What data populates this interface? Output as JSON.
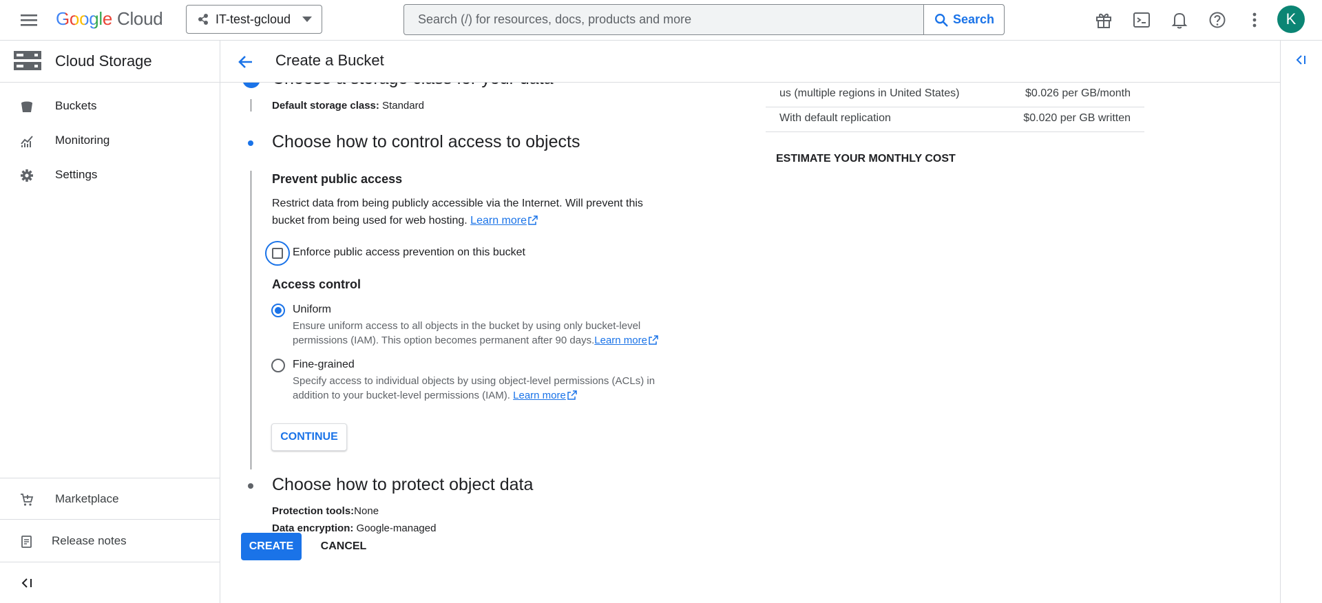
{
  "topbar": {
    "logo_google": "Google",
    "logo_cloud": "Cloud",
    "project_name": "IT-test-gcloud",
    "search_placeholder": "Search (/) for resources, docs, products and more",
    "search_button": "Search",
    "avatar_letter": "K"
  },
  "colors": {
    "accent": "#1a73e8",
    "avatar": "#0b8574",
    "border": "#dadce0"
  },
  "sidebar": {
    "product_title": "Cloud Storage",
    "items": [
      {
        "label": "Buckets",
        "icon": "bucket-icon"
      },
      {
        "label": "Monitoring",
        "icon": "monitoring-icon"
      },
      {
        "label": "Settings",
        "icon": "gear-icon"
      }
    ],
    "bottom_items": [
      {
        "label": "Marketplace",
        "icon": "cart-icon"
      },
      {
        "label": "Release notes",
        "icon": "release-notes-icon"
      }
    ]
  },
  "main": {
    "title": "Create a Bucket",
    "step_storage_class": {
      "title": "Choose a storage class for your data",
      "default_label": "Default storage class:",
      "default_value": " Standard"
    },
    "step_access": {
      "title": "Choose how to control access to objects",
      "prevent_heading": "Prevent public access",
      "prevent_desc_line1": "Restrict data from being publicly accessible via the Internet. Will prevent this",
      "prevent_desc_line2": "bucket from being used for web hosting.",
      "learn_more": "Learn more",
      "enforce_label": "Enforce public access prevention on this bucket",
      "enforce_checked": false,
      "access_control_heading": "Access control",
      "options": [
        {
          "label": "Uniform",
          "selected": true,
          "desc_line1": "Ensure uniform access to all objects in the bucket by using only bucket-level",
          "desc_line2": "permissions (IAM). This option becomes permanent after 90 days."
        },
        {
          "label": "Fine-grained",
          "selected": false,
          "desc_line1": "Specify access to individual objects by using object-level permissions (ACLs) in",
          "desc_line2": "addition to your bucket-level permissions (IAM)."
        }
      ],
      "continue_button": "CONTINUE"
    },
    "step_protect": {
      "title": "Choose how to protect object data",
      "protection_label": "Protection tools:",
      "protection_value": "None",
      "encryption_label": "Data encryption:",
      "encryption_value": " Google-managed"
    },
    "create_button": "CREATE",
    "cancel_button": "CANCEL"
  },
  "pricing": {
    "rows": [
      {
        "label": "us (multiple regions in United States)",
        "value": "$0.026 per GB/month"
      },
      {
        "label": "With default replication",
        "value": "$0.020 per GB written"
      }
    ],
    "estimate_link": "ESTIMATE YOUR MONTHLY COST"
  }
}
